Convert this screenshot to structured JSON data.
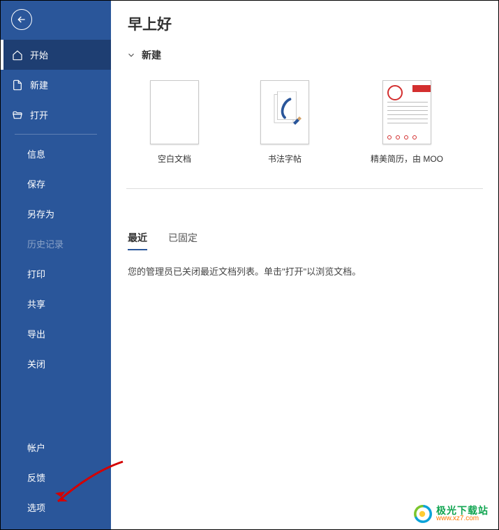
{
  "sidebar": {
    "top": [
      {
        "label": "开始",
        "icon": "home-icon"
      },
      {
        "label": "新建",
        "icon": "document-icon"
      },
      {
        "label": "打开",
        "icon": "folder-open-icon"
      }
    ],
    "middle": [
      {
        "label": "信息"
      },
      {
        "label": "保存"
      },
      {
        "label": "另存为"
      },
      {
        "label": "历史记录",
        "disabled": true
      },
      {
        "label": "打印"
      },
      {
        "label": "共享"
      },
      {
        "label": "导出"
      },
      {
        "label": "关闭"
      }
    ],
    "bottom": [
      {
        "label": "帐户"
      },
      {
        "label": "反馈"
      },
      {
        "label": "选项"
      }
    ]
  },
  "main": {
    "title": "早上好",
    "new_section": "新建",
    "templates": [
      {
        "label": "空白文档"
      },
      {
        "label": "书法字帖"
      },
      {
        "label": "精美简历，由 MOO"
      }
    ],
    "tabs": {
      "recent": "最近",
      "pinned": "已固定"
    },
    "empty_message": "您的管理员已关闭最近文档列表。单击\"打开\"以浏览文档。"
  },
  "watermark": {
    "cn": "极光下载站",
    "url": "www.xz7.com"
  }
}
